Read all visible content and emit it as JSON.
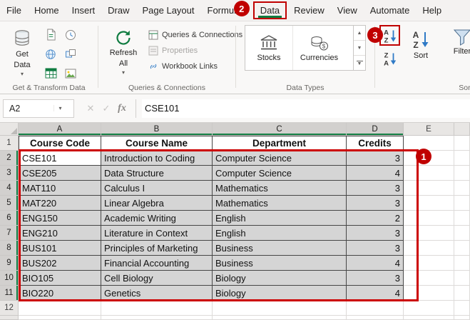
{
  "colors": {
    "annotation_red": "#c00000",
    "excel_green": "#107c41",
    "selection_fill": "#d5d5d5"
  },
  "ribbon": {
    "tabs": [
      "File",
      "Home",
      "Insert",
      "Draw",
      "Page Layout",
      "Formulas",
      "Data",
      "Review",
      "View",
      "Automate",
      "Help"
    ],
    "active_tab": "Data",
    "get_transform": {
      "label": "Get & Transform Data",
      "get_data_line1": "Get",
      "get_data_line2": "Data"
    },
    "queries": {
      "label": "Queries & Connections",
      "refresh_line1": "Refresh",
      "refresh_line2": "All",
      "items": [
        "Queries & Connections",
        "Properties",
        "Workbook Links"
      ]
    },
    "data_types": {
      "label": "Data Types",
      "items": [
        "Stocks",
        "Currencies"
      ]
    },
    "sort_filter": {
      "label": "Sort & Filter",
      "sort": "Sort",
      "filter": "Filter"
    }
  },
  "formula_bar": {
    "name_box": "A2",
    "fx": "fx",
    "formula": "CSE101"
  },
  "sheet": {
    "col_headers": [
      "A",
      "B",
      "C",
      "D",
      "E"
    ],
    "row_headers": [
      "1",
      "2",
      "3",
      "4",
      "5",
      "6",
      "7",
      "8",
      "9",
      "10",
      "11",
      "12"
    ],
    "table_header": [
      "Course Code",
      "Course Name",
      "Department",
      "Credits"
    ],
    "rows": [
      {
        "code": "CSE101",
        "name": "Introduction to Coding",
        "dept": "Computer Science",
        "credits": "3"
      },
      {
        "code": "CSE205",
        "name": "Data Structure",
        "dept": "Computer Science",
        "credits": "4"
      },
      {
        "code": "MAT110",
        "name": "Calculus I",
        "dept": "Mathematics",
        "credits": "3"
      },
      {
        "code": "MAT220",
        "name": "Linear Algebra",
        "dept": "Mathematics",
        "credits": "3"
      },
      {
        "code": "ENG150",
        "name": "Academic Writing",
        "dept": "English",
        "credits": "2"
      },
      {
        "code": "ENG210",
        "name": "Literature in Context",
        "dept": "English",
        "credits": "3"
      },
      {
        "code": "BUS101",
        "name": "Principles of Marketing",
        "dept": "Business",
        "credits": "3"
      },
      {
        "code": "BUS202",
        "name": "Financial Accounting",
        "dept": "Business",
        "credits": "4"
      },
      {
        "code": "BIO105",
        "name": "Cell Biology",
        "dept": "Biology",
        "credits": "3"
      },
      {
        "code": "BIO220",
        "name": "Genetics",
        "dept": "Biology",
        "credits": "4"
      }
    ]
  },
  "annotations": {
    "badge_1": "1",
    "badge_2": "2",
    "badge_3": "3"
  }
}
